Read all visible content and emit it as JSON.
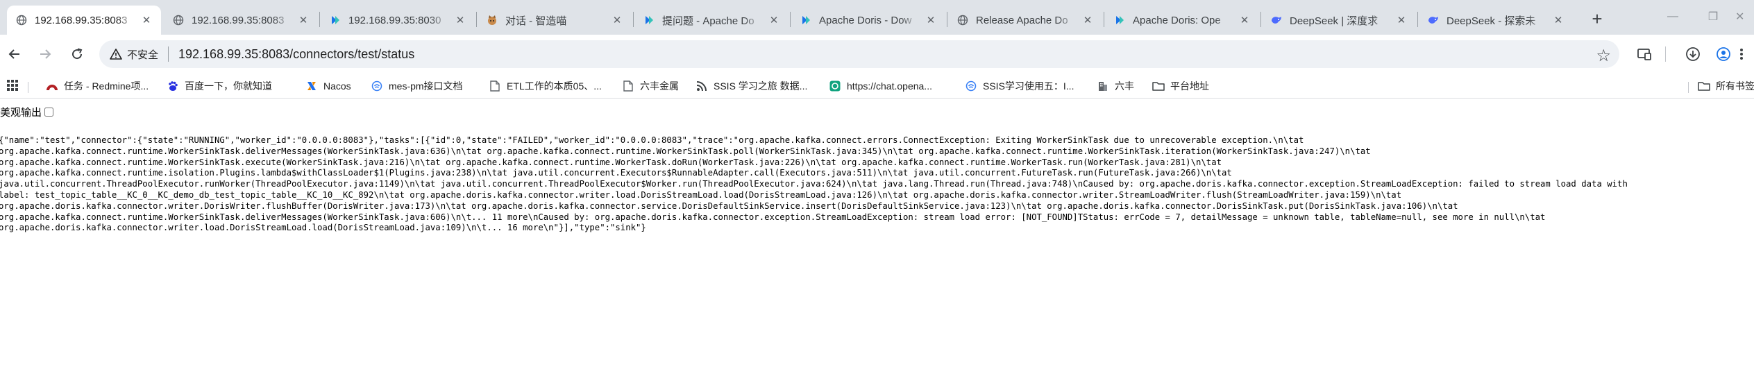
{
  "tabs": [
    {
      "title": "192.168.99.35:8083",
      "icon": "globe-icon",
      "active": true
    },
    {
      "title": "192.168.99.35:8083",
      "icon": "globe-icon"
    },
    {
      "title": "192.168.99.35:8030",
      "icon": "doris-icon"
    },
    {
      "title": "对话 - 智造喵",
      "icon": "cat-avatar-icon"
    },
    {
      "title": "提问题 - Apache Do",
      "icon": "doris-icon"
    },
    {
      "title": "Apache Doris - Dow",
      "icon": "doris-icon"
    },
    {
      "title": "Release Apache Do",
      "icon": "globe-icon"
    },
    {
      "title": "Apache Doris: Ope",
      "icon": "doris-icon"
    },
    {
      "title": "DeepSeek | 深度求",
      "icon": "deepseek-icon"
    },
    {
      "title": "DeepSeek - 探索未",
      "icon": "deepseek-icon"
    }
  ],
  "address": {
    "security_label": "不安全",
    "url": "192.168.99.35:8083/connectors/test/status"
  },
  "bookmarks": [
    {
      "label": "任务 - Redmine项...",
      "icon": "redmine-icon"
    },
    {
      "label": "百度一下，你就知道",
      "icon": "baidu-icon"
    },
    {
      "label": "Nacos",
      "icon": "nacos-icon"
    },
    {
      "label": "mes-pm接口文档",
      "icon": "api-doc-icon"
    },
    {
      "label": "ETL工作的本质05、...",
      "icon": "doc-icon"
    },
    {
      "label": "六丰金属",
      "icon": "doc-icon"
    },
    {
      "label": "SSIS 学习之旅 数据...",
      "icon": "cnblogs-icon"
    },
    {
      "label": "https://chat.opena...",
      "icon": "openai-icon"
    },
    {
      "label": "SSIS学习使用五：I...",
      "icon": "csdn-icon"
    },
    {
      "label": "六丰",
      "icon": "building-icon"
    },
    {
      "label": "平台地址",
      "icon": "folder-icon"
    }
  ],
  "bookmarks_all_label": "所有书签",
  "page": {
    "pretty_print_label": "美观输出",
    "pretty_print_checked": false,
    "json_lines": [
      "{\"name\":\"test\",\"connector\":{\"state\":\"RUNNING\",\"worker_id\":\"0.0.0.0:8083\"},\"tasks\":[{\"id\":0,\"state\":\"FAILED\",\"worker_id\":\"0.0.0.0:8083\",\"trace\":\"org.apache.kafka.connect.errors.ConnectException: Exiting WorkerSinkTask due to unrecoverable exception.\\n\\tat",
      "org.apache.kafka.connect.runtime.WorkerSinkTask.deliverMessages(WorkerSinkTask.java:636)\\n\\tat org.apache.kafka.connect.runtime.WorkerSinkTask.poll(WorkerSinkTask.java:345)\\n\\tat org.apache.kafka.connect.runtime.WorkerSinkTask.iteration(WorkerSinkTask.java:247)\\n\\tat",
      "org.apache.kafka.connect.runtime.WorkerSinkTask.execute(WorkerSinkTask.java:216)\\n\\tat org.apache.kafka.connect.runtime.WorkerTask.doRun(WorkerTask.java:226)\\n\\tat org.apache.kafka.connect.runtime.WorkerTask.run(WorkerTask.java:281)\\n\\tat",
      "org.apache.kafka.connect.runtime.isolation.Plugins.lambda$withClassLoader$1(Plugins.java:238)\\n\\tat java.util.concurrent.Executors$RunnableAdapter.call(Executors.java:511)\\n\\tat java.util.concurrent.FutureTask.run(FutureTask.java:266)\\n\\tat",
      "java.util.concurrent.ThreadPoolExecutor.runWorker(ThreadPoolExecutor.java:1149)\\n\\tat java.util.concurrent.ThreadPoolExecutor$Worker.run(ThreadPoolExecutor.java:624)\\n\\tat java.lang.Thread.run(Thread.java:748)\\nCaused by: org.apache.doris.kafka.connector.exception.StreamLoadException: failed to stream load data with",
      "label: test_topic_table__KC_0__KC_demo_db_test_topic_table__KC_10__KC_892\\n\\tat org.apache.doris.kafka.connector.writer.load.DorisStreamLoad.load(DorisStreamLoad.java:126)\\n\\tat org.apache.doris.kafka.connector.writer.StreamLoadWriter.flush(StreamLoadWriter.java:159)\\n\\tat",
      "org.apache.doris.kafka.connector.writer.DorisWriter.flushBuffer(DorisWriter.java:173)\\n\\tat org.apache.doris.kafka.connector.service.DorisDefaultSinkService.insert(DorisDefaultSinkService.java:123)\\n\\tat org.apache.doris.kafka.connector.DorisSinkTask.put(DorisSinkTask.java:106)\\n\\tat",
      "org.apache.kafka.connect.runtime.WorkerSinkTask.deliverMessages(WorkerSinkTask.java:606)\\n\\t... 11 more\\nCaused by: org.apache.doris.kafka.connector.exception.StreamLoadException: stream load error: [NOT_FOUND]TStatus: errCode = 7, detailMessage = unknown table, tableName=null, see more in null\\n\\tat",
      "org.apache.doris.kafka.connector.writer.load.DorisStreamLoad.load(DorisStreamLoad.java:109)\\n\\t... 16 more\\n\"}],\"type\":\"sink\"}"
    ]
  }
}
